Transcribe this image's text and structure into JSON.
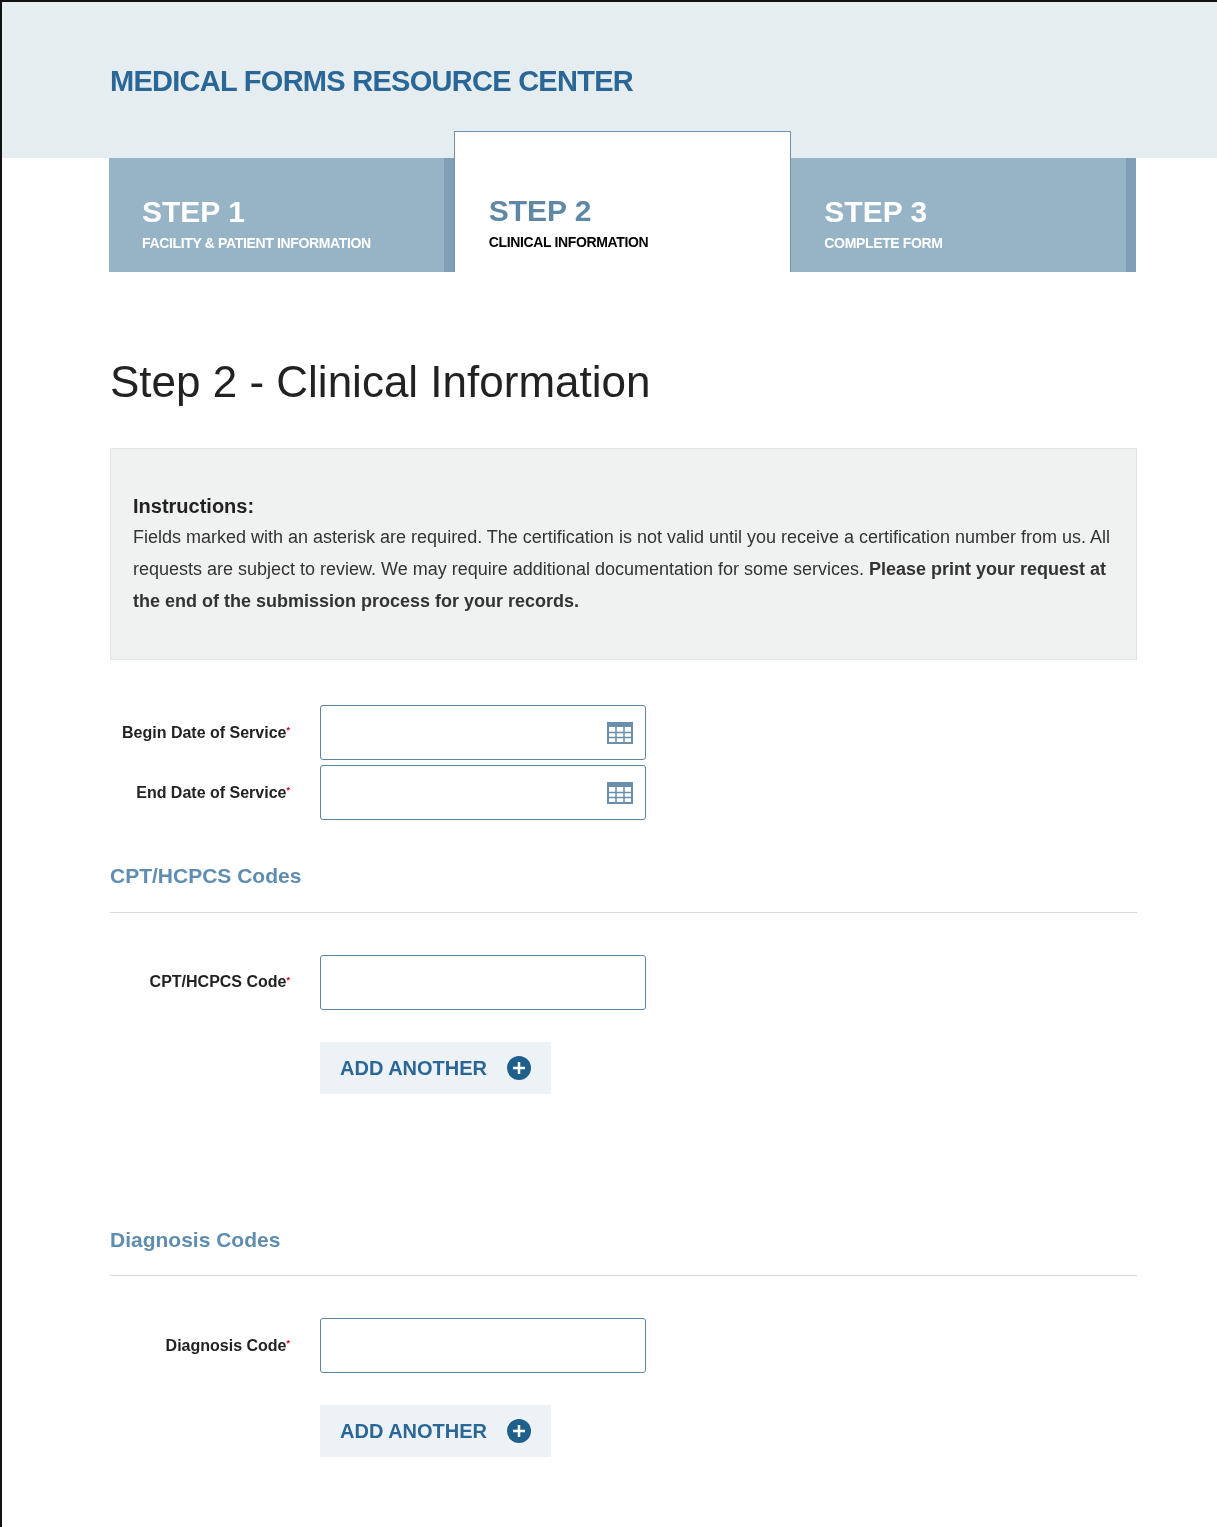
{
  "header": {
    "title": "MEDICAL FORMS RESOURCE CENTER"
  },
  "steps": [
    {
      "label": "STEP 1",
      "subtitle": "FACILITY & PATIENT INFORMATION",
      "selected": false
    },
    {
      "label": "STEP 2",
      "subtitle": "CLINICAL INFORMATION",
      "selected": true
    },
    {
      "label": "STEP 3",
      "subtitle": "COMPLETE FORM",
      "selected": false
    }
  ],
  "page_title": "Step 2 - Clinical Information",
  "instructions": {
    "heading": "Instructions:",
    "text": "Fields marked with an asterisk are required. The certification is not valid until you receive a certification number from us. All requests are subject to review. We may require additional documentation for some services. **Please print your request at the end of the submission process for your records.**"
  },
  "date_fields": [
    {
      "label": "Begin Date of Service$^{*}$",
      "kind": "date"
    },
    {
      "label": "End Date of Service$^{*}$",
      "kind": "date"
    }
  ],
  "sections": [
    {
      "title": "CPT/HCPCS Codes",
      "fields": [
        {
          "label": "CPT/HCPCS Code$^{*}$",
          "kind": "text"
        }
      ],
      "add_button": "ADD ANOTHER"
    },
    {
      "title": "Diagnosis Codes",
      "fields": [
        {
          "label": "Diagnosis Code$^{*}$",
          "kind": "text"
        }
      ],
      "add_button": "ADD ANOTHER"
    }
  ]
}
